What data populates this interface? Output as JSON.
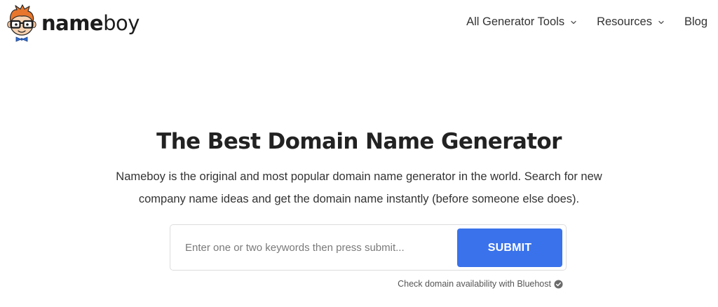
{
  "brand": {
    "name_bold": "name",
    "name_light": "boy"
  },
  "nav": {
    "items": [
      {
        "label": "All Generator Tools",
        "has_dropdown": true
      },
      {
        "label": "Resources",
        "has_dropdown": true
      },
      {
        "label": "Blog",
        "has_dropdown": false
      }
    ]
  },
  "hero": {
    "title": "The Best Domain Name Generator",
    "description": "Nameboy is the original and most popular domain name generator in the world. Search for new company name ideas and get the domain name instantly (before someone else does)."
  },
  "search": {
    "value": "",
    "placeholder": "Enter one or two keywords then press submit...",
    "submit_label": "SUBMIT"
  },
  "availability": {
    "text": "Check domain availability with Bluehost",
    "icon": "check-circle-icon"
  },
  "colors": {
    "accent": "#3a72eb",
    "logo_hair": "#e8762c",
    "logo_bowtie": "#2f6fd6",
    "text": "#222222"
  }
}
